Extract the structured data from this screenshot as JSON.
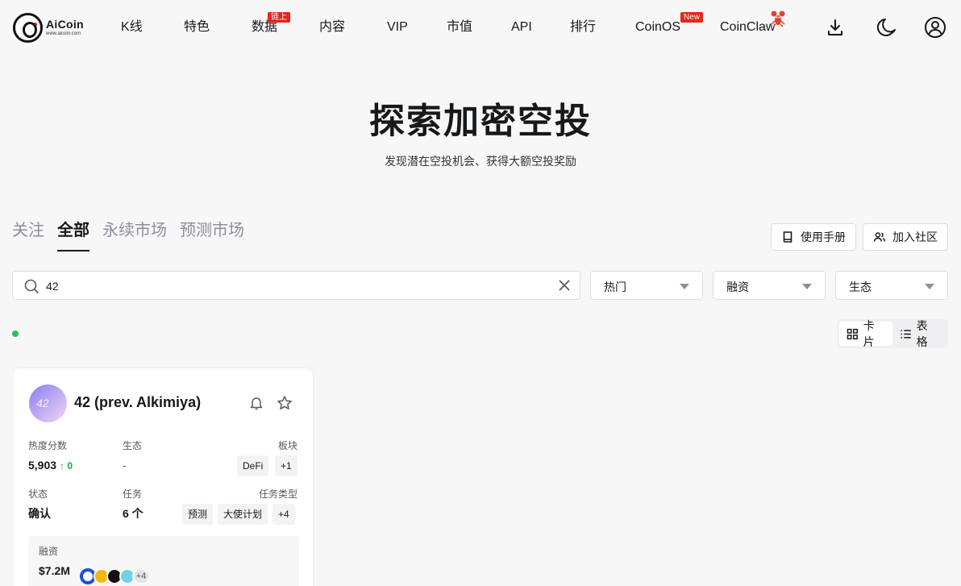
{
  "header": {
    "logo_name": "AiCoin",
    "logo_url": "www.aicoin.com",
    "nav": [
      {
        "label": "K线"
      },
      {
        "label": "特色"
      },
      {
        "label": "数据",
        "badge": "链上"
      },
      {
        "label": "内容"
      },
      {
        "label": "VIP"
      },
      {
        "label": "市值"
      },
      {
        "label": "API"
      },
      {
        "label": "排行"
      },
      {
        "label": "CoinOS",
        "badge": "New"
      },
      {
        "label": "CoinClaw"
      }
    ]
  },
  "hero": {
    "title": "探索加密空投",
    "subtitle": "发现潜在空投机会、获得大额空投奖励"
  },
  "tabs": [
    {
      "label": "关注",
      "active": false
    },
    {
      "label": "全部",
      "active": true
    },
    {
      "label": "永续市场",
      "active": false
    },
    {
      "label": "预测市场",
      "active": false
    }
  ],
  "actions": {
    "manual": "使用手册",
    "community": "加入社区"
  },
  "filters": {
    "search_value": "42",
    "selects": [
      "热门",
      "融资",
      "生态"
    ]
  },
  "view_toggle": {
    "card": "卡片",
    "table": "表格",
    "selected": "card"
  },
  "project_card": {
    "avatar_text": "42",
    "name": "42 (prev. Alkimiya)",
    "heat_label": "热度分数",
    "heat_value": "5,903",
    "heat_change": "↑ 0",
    "eco_label": "生态",
    "eco_value": "-",
    "sector_label": "板块",
    "sector_tags": [
      "DeFi",
      "+1"
    ],
    "status_label": "状态",
    "status_value": "确认",
    "tasks_label": "任务",
    "tasks_value": "6 个",
    "task_type_label": "任务类型",
    "task_type_tags": [
      "预测",
      "大使计划",
      "+4"
    ],
    "funding_label": "融资",
    "funding_value": "$7.2M",
    "investors_more": "+4"
  },
  "colors": {
    "badge_red": "#e5261d",
    "positive_green": "#16a34a",
    "live_dot": "#22c35e"
  }
}
